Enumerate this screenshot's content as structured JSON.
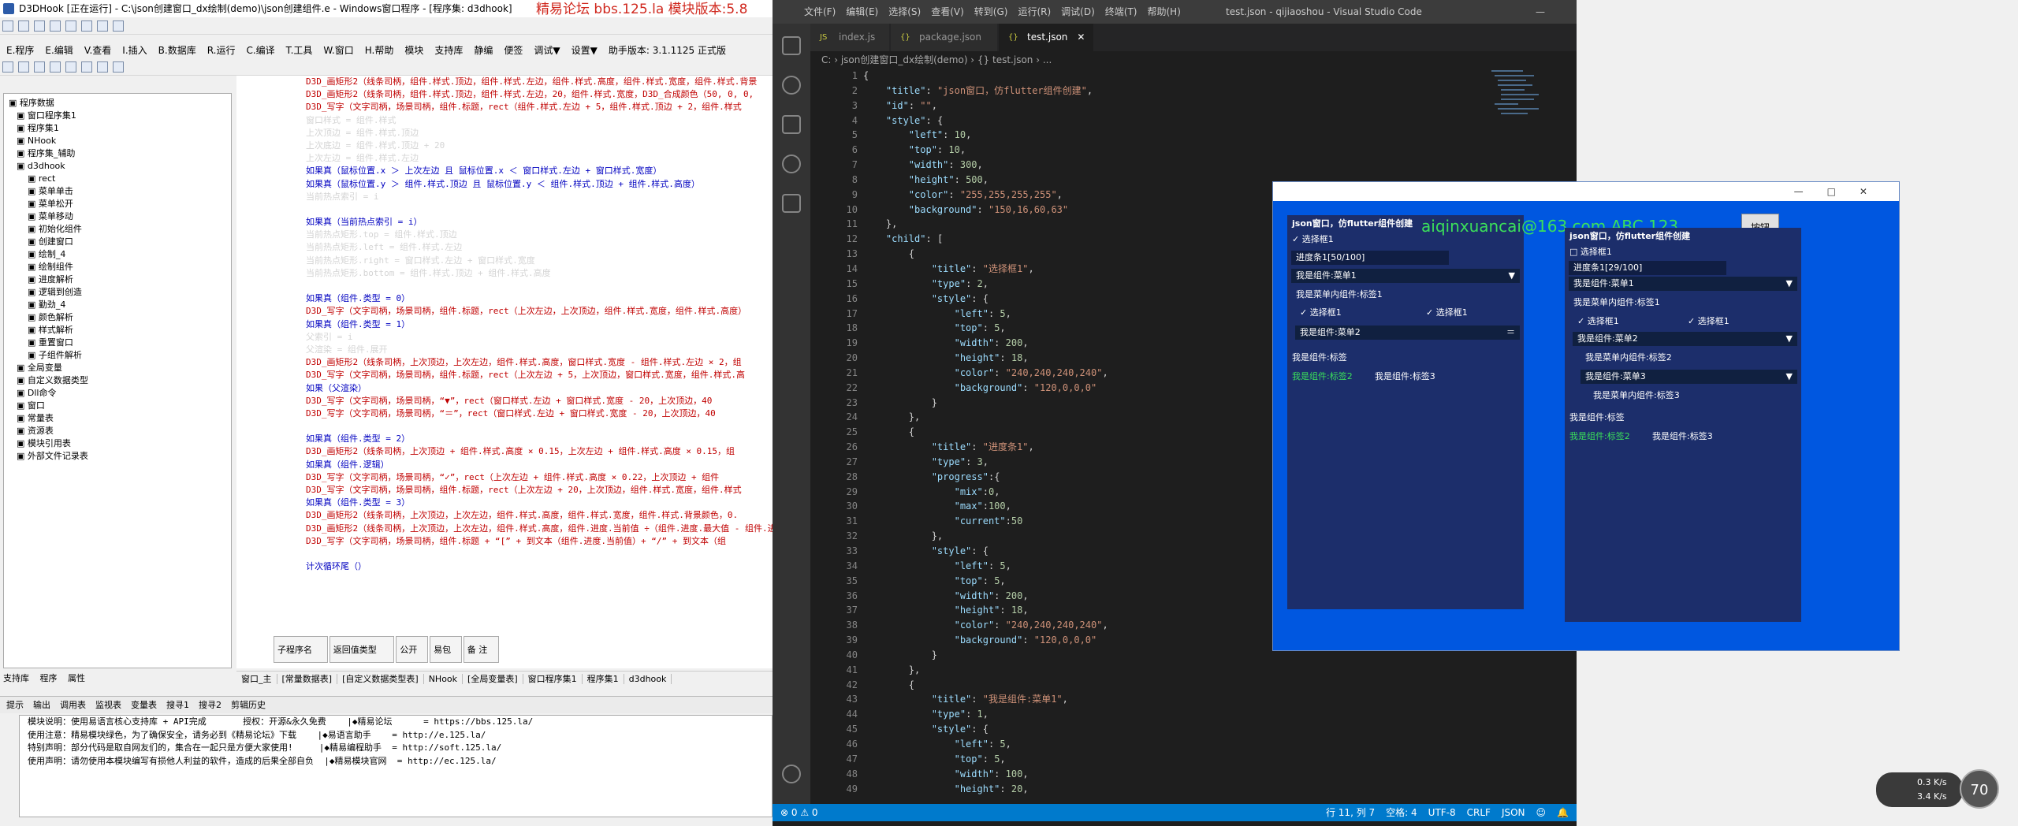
{
  "ide": {
    "title": "D3DHook [正在运行] - C:\\json创建窗口_dx绘制(demo)\\json创建组件.e - Windows窗口程序 - [程序集: d3dhook]",
    "ad": "精易论坛 bbs.125.la 模块版本:5.8",
    "menu": [
      "E.程序",
      "E.编辑",
      "V.查看",
      "I.插入",
      "B.数据库",
      "R.运行",
      "C.编译",
      "T.工具",
      "W.窗口",
      "H.帮助",
      "模块",
      "支持库",
      "静编",
      "便签",
      "调试▼",
      "设置▼",
      "助手版本: 3.1.1125 正式版"
    ],
    "tree": [
      "程序数据",
      "窗口程序集1",
      "程序集1",
      "NHook",
      "程序集_辅助",
      "d3dhook",
      "rect",
      "菜单单击",
      "菜单松开",
      "菜单移动",
      "初始化组件",
      "创建窗口",
      "绘制_4",
      "绘制组件",
      "进度解析",
      "逻辑到创造",
      "勤劲_4",
      "颜色解析",
      "样式解析",
      "重置窗口",
      "子组件解析",
      "全局变量",
      "自定义数据类型",
      "Dll命令",
      "窗口",
      "常量表",
      "资源表",
      "模块引用表",
      "外部文件记录表"
    ],
    "code": [
      [
        "fn",
        "D3D_画矩形2（线条司柄，组件.样式.顶边，组件.样式.左边，组件.样式.高度，组件.样式.宽度，组件.样式.背景"
      ],
      [
        "fn",
        "D3D_画矩形2（线条司柄，组件.样式.顶边，组件.样式.左边，20，组件.样式.宽度，D3D_合成颜色（50, 0, 0,"
      ],
      [
        "fn",
        "D3D_写字（文字司柄，场景司柄，组件.标题，rect（组件.样式.左边 + 5，组件.样式.顶边 + 2，组件.样式"
      ],
      [
        "p",
        "窗口样式 = 组件.样式"
      ],
      [
        "p",
        "上次顶边 = 组件.样式.顶边"
      ],
      [
        "p",
        "上次底边 = 组件.样式.顶边 + 20"
      ],
      [
        "p",
        "上次左边 = 组件.样式.左边"
      ],
      [
        "kw",
        "  如果真（鼠标位置.x ＞ 上次左边 且 鼠标位置.x ＜ 窗口样式.左边 + 窗口样式.宽度）"
      ],
      [
        "kw",
        "    如果真（鼠标位置.y ＞ 组件.样式.顶边 且 鼠标位置.y ＜ 组件.样式.顶边 + 组件.样式.高度）"
      ],
      [
        "p",
        "      当前热点索引 = i"
      ],
      [
        "p",
        ""
      ],
      [
        "kw",
        "  如果真（当前热点索引 = i）"
      ],
      [
        "p",
        "    当前热点矩形.top = 组件.样式.顶边"
      ],
      [
        "p",
        "    当前热点矩形.left = 组件.样式.左边"
      ],
      [
        "p",
        "    当前热点矩形.right = 窗口样式.左边 + 窗口样式.宽度"
      ],
      [
        "p",
        "    当前热点矩形.bottom = 组件.样式.顶边 + 组件.样式.高度"
      ],
      [
        "p",
        ""
      ],
      [
        "kw",
        "如果真（组件.类型 = 0）"
      ],
      [
        "fn",
        "D3D_写字（文字司柄，场景司柄，组件.标题，rect（上次左边，上次顶边，组件.样式.宽度，组件.样式.高度）"
      ],
      [
        "kw",
        "如果真（组件.类型 = 1）"
      ],
      [
        "p",
        "父索引 = i"
      ],
      [
        "p",
        "父渲染 = 组件.展开"
      ],
      [
        "fn",
        "D3D_画矩形2（线条司柄，上次顶边，上次左边，组件.样式.高度，窗口样式.宽度 - 组件.样式.左边 × 2，组"
      ],
      [
        "fn",
        "D3D_写字（文字司柄，场景司柄，组件.标题，rect（上次左边 + 5，上次顶边，窗口样式.宽度，组件.样式.高"
      ],
      [
        "kw",
        "  如果（父渲染）"
      ],
      [
        "fn",
        "  D3D_写字（文字司柄，场景司柄，“▼”，rect（窗口样式.左边 + 窗口样式.宽度 - 20，上次顶边，40"
      ],
      [
        "fn",
        "  D3D_写字（文字司柄，场景司柄，“＝”，rect（窗口样式.左边 + 窗口样式.宽度 - 20，上次顶边，40"
      ],
      [
        "p",
        ""
      ],
      [
        "kw",
        "如果真（组件.类型 = 2）"
      ],
      [
        "fn",
        "D3D_画矩形2（线条司柄，上次顶边 + 组件.样式.高度 × 0.15，上次左边 + 组件.样式.高度 × 0.15，组"
      ],
      [
        "kw",
        "  如果真（组件.逻辑）"
      ],
      [
        "fn",
        "  D3D_写字（文字司柄，场景司柄，“✓”，rect（上次左边 + 组件.样式.高度 × 0.22，上次顶边 + 组件"
      ],
      [
        "fn",
        "D3D_写字（文字司柄，场景司柄，组件.标题，rect（上次左边 + 20，上次顶边，组件.样式.宽度，组件.样式"
      ],
      [
        "kw",
        "如果真（组件.类型 = 3）"
      ],
      [
        "fn",
        "D3D_画矩形2（线条司柄，上次顶边，上次左边，组件.样式.高度，组件.样式.宽度，组件.样式.背景颜色，0."
      ],
      [
        "fn",
        "D3D_画矩形2（线条司柄，上次顶边，上次左边，组件.样式.高度，组件.进度.当前值 ÷（组件.进度.最大值 - 组件.进度.最"
      ],
      [
        "fn",
        "D3D_写字（文字司柄，场景司柄，组件.标题 + “[” + 到文本（组件.进度.当前值）+ “/” + 到文本（组"
      ],
      [
        "p",
        ""
      ],
      [
        "kw",
        "计次循环尾（）"
      ]
    ],
    "subtable": [
      "子程序名",
      "返回值类型",
      "公开",
      "易包",
      "备 注"
    ],
    "side_tabs": [
      "支持库",
      "程序",
      "属性"
    ],
    "bottom_tabs": [
      "窗口_主",
      "[常量数据表]",
      "[自定义数据类型表]",
      "NHook",
      "[全局变量表]",
      "窗口程序集1",
      "程序集1",
      "d3dhook"
    ],
    "out_tabs": [
      "提示",
      "输出",
      "调用表",
      "监视表",
      "变量表",
      "搜寻1",
      "搜寻2",
      "剪辑历史"
    ],
    "output": [
      "模块说明：使用易语言核心支持库 + API完成       授权：开源&永久免费    |◆精易论坛      = https://bbs.125.la/",
      "使用注意：精易模块绿色，为了确保安全，请务必到《精易论坛》下载    |◆易语言助手    = http://e.125.la/",
      "特别声明：部分代码是取自网友们的，集合在一起只是方便大家使用!     |◆精易编程助手  = http://soft.125.la/",
      "使用声明：请勿使用本模块编写有损他人利益的软件，造成的后果全部自负  |◆精易模块官网  = http://ec.125.la/"
    ]
  },
  "vscode": {
    "menu": [
      "文件(F)",
      "编辑(E)",
      "选择(S)",
      "查看(V)",
      "转到(G)",
      "运行(R)",
      "调试(D)",
      "终端(T)",
      "帮助(H)"
    ],
    "title": "test.json - qijiaoshou - Visual Studio Code",
    "tabs": [
      "index.js",
      "package.json",
      "test.json"
    ],
    "breadcrumb": "C: › json创建窗口_dx绘制(demo) › {} test.json › ...",
    "status_left": "⊗ 0 ⚠ 0",
    "status_right": [
      "行 11, 列 7",
      "空格: 4",
      "UTF-8",
      "CRLF",
      "JSON",
      "☺",
      "🔔"
    ],
    "code": [
      "{",
      "    \"title\": \"json窗口，仿flutter组件创建\",",
      "    \"id\": \"\",",
      "    \"style\": {",
      "        \"left\": 10,",
      "        \"top\": 10,",
      "        \"width\": 300,",
      "        \"height\": 500,",
      "        \"color\": \"255,255,255,255\",",
      "        \"background\": \"150,16,60,63\"",
      "    },",
      "    \"child\": [",
      "        {",
      "            \"title\": \"选择框1\",",
      "            \"type\": 2,",
      "            \"style\": {",
      "                \"left\": 5,",
      "                \"top\": 5,",
      "                \"width\": 200,",
      "                \"height\": 18,",
      "                \"color\": \"240,240,240,240\",",
      "                \"background\": \"120,0,0,0\"",
      "            }",
      "        },",
      "        {",
      "            \"title\": \"进度条1\",",
      "            \"type\": 3,",
      "            \"progress\":{",
      "                \"mix\":0,",
      "                \"max\":100,",
      "                \"current\":50",
      "            },",
      "            \"style\": {",
      "                \"left\": 5,",
      "                \"top\": 5,",
      "                \"width\": 200,",
      "                \"height\": 18,",
      "                \"color\": \"240,240,240,240\",",
      "                \"background\": \"120,0,0,0\"",
      "            }",
      "        },",
      "        {",
      "            \"title\": \"我是组件:菜单1\",",
      "            \"type\": 1,",
      "            \"style\": {",
      "                \"left\": 5,",
      "                \"top\": 5,",
      "                \"width\": 100,",
      "                \"height\": 20,"
    ]
  },
  "jsonwin": {
    "title": "json窗口，仿flutter组件创建",
    "button": "按钮",
    "watermark": "aiqinxuancai@163.com ABC 123",
    "left_panel": {
      "checkbox": "选择框1",
      "progress": "进度条1[50/100]",
      "menu1": "我是组件:菜单1",
      "inner": "我是菜单内组件:标签1",
      "cb_a": "选择框1",
      "cb_b": "选择框1",
      "menu2": "我是组件:菜单2",
      "label": "我是组件:标签",
      "label2": "我是组件:标签2",
      "label3": "我是组件:标签3"
    },
    "right_panel": {
      "title": "json窗口，仿flutter组件创建",
      "checkbox": "选择框1",
      "progress": "进度条1[29/100]",
      "menu1": "我是组件:菜单1",
      "inner1": "我是菜单内组件:标签1",
      "cb_a": "选择框1",
      "cb_b": "选择框1",
      "menu2": "我是组件:菜单2",
      "inner2": "我是菜单内组件:标签2",
      "menu3": "我是组件:菜单3",
      "inner3": "我是菜单内组件:标签3",
      "label": "我是组件:标签",
      "label2": "我是组件:标签2",
      "label3": "我是组件:标签3"
    }
  },
  "tray": {
    "gauge": "70",
    "up": "0.3",
    "down": "3.4",
    "unit": "K/s"
  }
}
